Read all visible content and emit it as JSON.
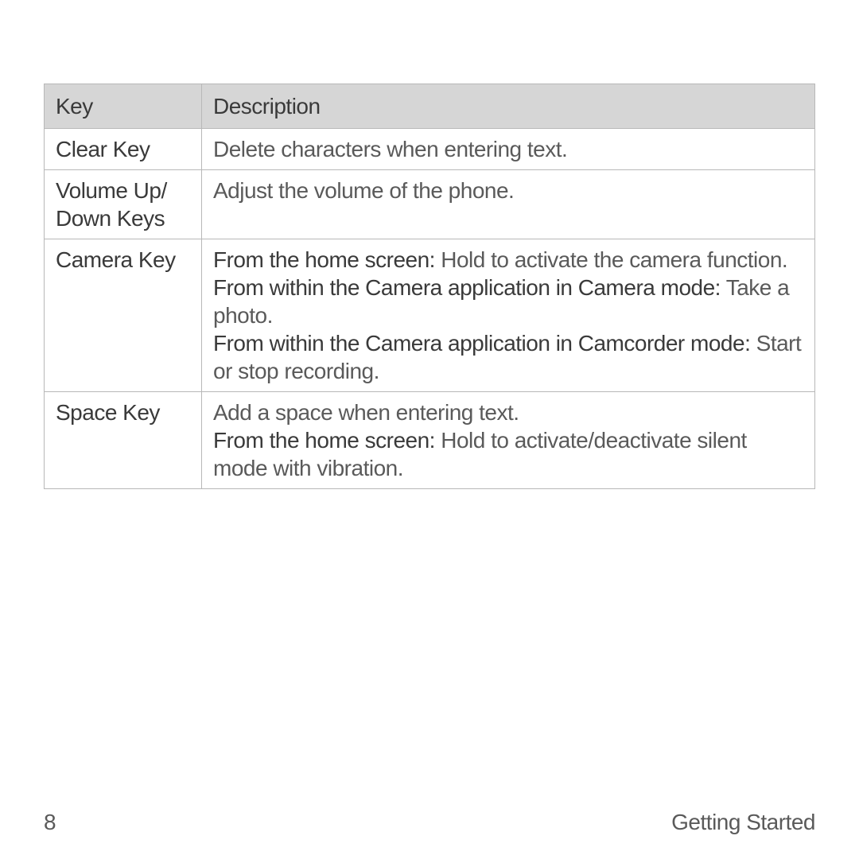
{
  "table": {
    "headers": {
      "key": "Key",
      "description": "Description"
    },
    "rows": [
      {
        "key": "Clear Key",
        "desc_plain": "Delete characters when entering text."
      },
      {
        "key": "Volume Up/ Down Keys",
        "desc_plain": "Adjust the volume of the phone."
      },
      {
        "key": "Camera Key",
        "desc_parts": {
          "b1": "From the home screen:",
          "t1": " Hold to activate the camera function.",
          "b2": "From within the Camera application in Camera mode:",
          "t2": " Take a photo.",
          "b3": "From within the Camera application in Camcorder mode:",
          "t3": " Start or stop recording."
        }
      },
      {
        "key": "Space Key",
        "desc_parts": {
          "t0": "Add a space when entering text.",
          "b1": "From the home screen:",
          "t1": " Hold to activate/deactivate silent mode with vibration."
        }
      }
    ]
  },
  "footer": {
    "page_number": "8",
    "section": "Getting Started"
  }
}
